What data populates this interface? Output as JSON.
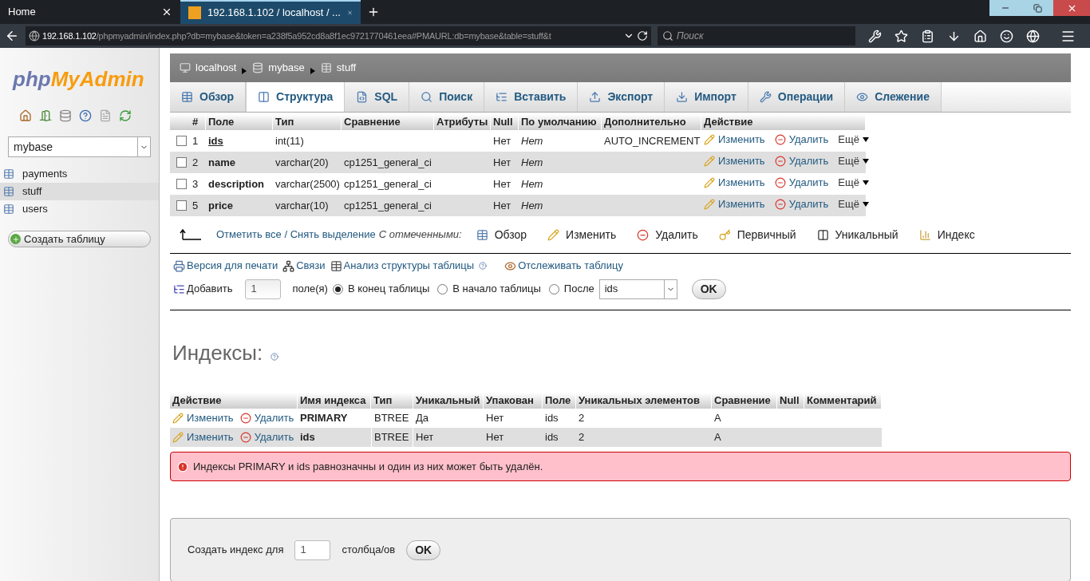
{
  "browser": {
    "tabs": [
      {
        "label": "Home",
        "selected": false
      },
      {
        "label": "192.168.1.102 / localhost / ...",
        "selected": true
      }
    ],
    "url": {
      "host": "192.168.1.102",
      "path": "/phpmyadmin/index.php?db=mybase&token=a238f5a952cd8a8f1ec9721770461eea#PMAURL:db=mybase&table=stuff&t"
    },
    "search": {
      "placeholder": "Поиск"
    }
  },
  "sidebar": {
    "logo": {
      "php": "php",
      "myadmin": "MyAdmin"
    },
    "database": "mybase",
    "tables": [
      {
        "name": "payments",
        "selected": false
      },
      {
        "name": "stuff",
        "selected": true
      },
      {
        "name": "users",
        "selected": false
      }
    ],
    "create_button": "Создать таблицу"
  },
  "breadcrumb": [
    "localhost",
    "mybase",
    "stuff"
  ],
  "tabs": [
    {
      "label": "Обзор",
      "selected": false
    },
    {
      "label": "Структура",
      "selected": true
    },
    {
      "label": "SQL",
      "selected": false
    },
    {
      "label": "Поиск",
      "selected": false
    },
    {
      "label": "Вставить",
      "selected": false
    },
    {
      "label": "Экспорт",
      "selected": false
    },
    {
      "label": "Импорт",
      "selected": false
    },
    {
      "label": "Операции",
      "selected": false
    },
    {
      "label": "Слежение",
      "selected": false
    }
  ],
  "structure": {
    "columns": [
      "#",
      "Поле",
      "Тип",
      "Сравнение",
      "Атрибуты",
      "Null",
      "По умолчанию",
      "Дополнительно",
      "Действие"
    ],
    "rows": [
      {
        "checked": false,
        "num": "1",
        "field": "ids",
        "primary": true,
        "type": "int(11)",
        "null": "Нет",
        "default": "Нет",
        "extra": "AUTO_INCREMENT",
        "edit": "Изменить",
        "drop": "Удалить",
        "more": "Ещё"
      },
      {
        "checked": false,
        "num": "2",
        "field": "name",
        "primary": false,
        "type": "varchar(20)",
        "collation": "cp1251_general_ci",
        "null": "Нет",
        "default": "Нет",
        "edit": "Изменить",
        "drop": "Удалить",
        "more": "Ещё"
      },
      {
        "checked": false,
        "num": "3",
        "field": "description",
        "primary": false,
        "type": "varchar(2500)",
        "collation": "cp1251_general_ci",
        "null": "Нет",
        "default": "Нет",
        "edit": "Изменить",
        "drop": "Удалить",
        "more": "Ещё"
      },
      {
        "checked": false,
        "num": "5",
        "field": "price",
        "primary": false,
        "type": "varchar(10)",
        "collation": "cp1251_general_ci",
        "null": "Нет",
        "default": "Нет",
        "edit": "Изменить",
        "drop": "Удалить",
        "more": "Ещё"
      }
    ]
  },
  "bulk": {
    "check_all": "Отметить все / Снять выделение",
    "with_selected": "С отмеченными:",
    "actions": [
      {
        "kind": "browse",
        "label": "Обзор"
      },
      {
        "kind": "edit",
        "label": "Изменить"
      },
      {
        "kind": "drop",
        "label": "Удалить"
      },
      {
        "kind": "primary",
        "label": "Первичный"
      },
      {
        "kind": "unique",
        "label": "Уникальный"
      },
      {
        "kind": "index",
        "label": "Индекс"
      }
    ]
  },
  "links": [
    {
      "kind": "print",
      "label": "Версия для печати"
    },
    {
      "kind": "relations",
      "label": "Связи"
    },
    {
      "kind": "analyze",
      "label": "Анализ структуры таблицы"
    },
    {
      "kind": "track",
      "label": "Отслеживать таблицу"
    }
  ],
  "add_field": {
    "label": "Добавить",
    "count": "1",
    "unit": "поле(я)",
    "positions": [
      {
        "label": "В конец таблицы",
        "selected": true
      },
      {
        "label": "В начало таблицы",
        "selected": false
      },
      {
        "label": "После",
        "selected": false
      }
    ],
    "after": "ids",
    "ok": "OK"
  },
  "indexes": {
    "title": "Индексы:",
    "columns": [
      "Действие",
      "Имя индекса",
      "Тип",
      "Уникальный",
      "Упакован",
      "Поле",
      "Уникальных элементов",
      "Сравнение",
      "Null",
      "Комментарий"
    ],
    "rows": [
      {
        "edit": "Изменить",
        "drop": "Удалить",
        "name": "PRIMARY",
        "type": "BTREE",
        "unique": "Да",
        "packed": "Нет",
        "field": "ids",
        "cardinality": "2",
        "collation": "A"
      },
      {
        "edit": "Изменить",
        "drop": "Удалить",
        "name": "ids",
        "type": "BTREE",
        "unique": "Нет",
        "packed": "Нет",
        "field": "ids",
        "cardinality": "2",
        "collation": "A"
      }
    ],
    "warning": "Индексы PRIMARY и ids равнозначны и один из них может быть удалён."
  },
  "create_index": {
    "label": "Создать индекс для",
    "value": "1",
    "unit": "столбца/ов",
    "ok": "OK"
  }
}
